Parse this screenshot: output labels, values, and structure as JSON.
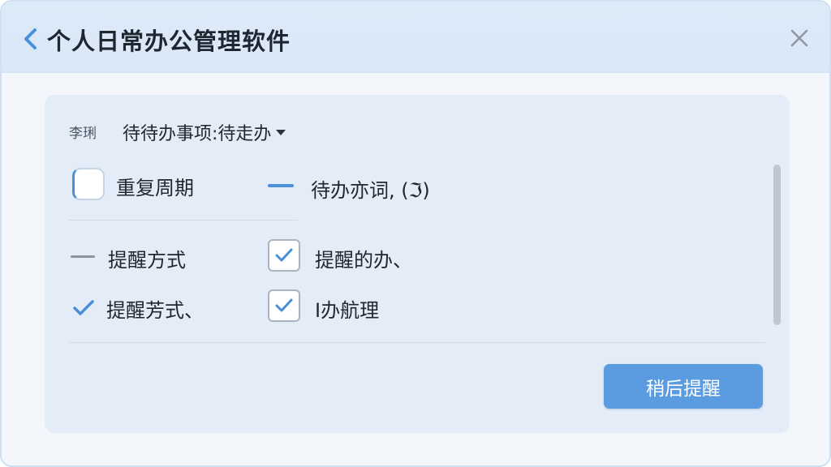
{
  "window": {
    "title": "个人日常办公管理软件",
    "back_icon": "chevron-left-icon",
    "close_icon": "close-icon"
  },
  "task": {
    "label": "李琍",
    "selected_item": "待待办事项:待走办",
    "dropdown_icon": "caret-down-icon"
  },
  "options": {
    "repeat_label": "重复周期",
    "todo_label": "待办亦词, (ℑ)",
    "method_label": "提醒方式",
    "method_checked_label": "提醒芳式、",
    "reminder_todo_label": "提醒的办、",
    "reminder_todo_checked": true,
    "handle_label": "I办航理",
    "handle_checked": true
  },
  "actions": {
    "snooze_label": "稍后提醒"
  },
  "colors": {
    "accent": "#4a90d9",
    "button": "#5b9be0",
    "titlebar": "#dbe8f7",
    "panel": "#e3ecf7"
  }
}
